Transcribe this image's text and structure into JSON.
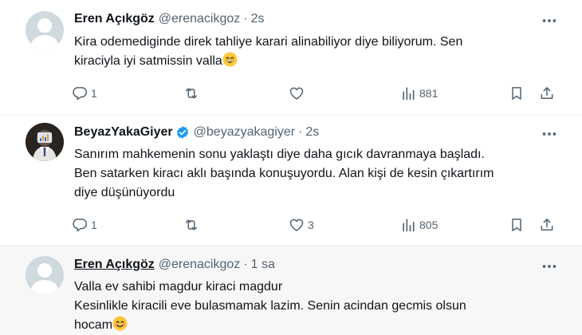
{
  "tweets": [
    {
      "name": "Eren Açıkgöz",
      "handle": "@erenacikgoz",
      "dot": "·",
      "time": "2s",
      "lines": [
        "Kira odemediginde direk tahliye karari alinabiliyor diye biliyorum. Sen",
        "kiraciyla iyi satmissin valla"
      ],
      "emoji": "grinning-face-emoji",
      "replies": "1",
      "retweets": "",
      "likes": "",
      "views": "881"
    },
    {
      "name": "BeyazYakaGiyer",
      "handle": "@beyazyakagiyer",
      "dot": "·",
      "time": "2s",
      "verified": true,
      "lines": [
        "Sanırım mahkemenin sonu yaklaştı diye daha gıcık davranmaya başladı.",
        "Ben satarken kiracı aklı başında konuşuyordu. Alan kişi de kesin çıkartırım",
        "diye düşünüyordu"
      ],
      "replies": "1",
      "retweets": "",
      "likes": "3",
      "views": "805"
    },
    {
      "name": "Eren Açıkgöz",
      "handle": "@erenacikgoz",
      "dot": "·",
      "time": "1 sa",
      "lines": [
        "Valla ev sahibi magdur kiraci magdur",
        "Kesinlikle kiracili eve bulasmamak lazim. Senin acindan gecmis olsun",
        "hocam"
      ],
      "emoji": "smiling-face-emoji"
    }
  ],
  "icons": {
    "more": "more-icon",
    "reply": "reply-icon",
    "retweet": "retweet-icon",
    "like": "heart-icon",
    "views": "views-icon",
    "bookmark": "bookmark-icon",
    "share": "share-icon",
    "verified": "verified-badge-icon"
  },
  "colors": {
    "text": "#0f1419",
    "secondary": "#536471",
    "verified": "#1d9bf0",
    "highlight_bg": "#f7f7f7",
    "divider": "#eff3f4"
  }
}
